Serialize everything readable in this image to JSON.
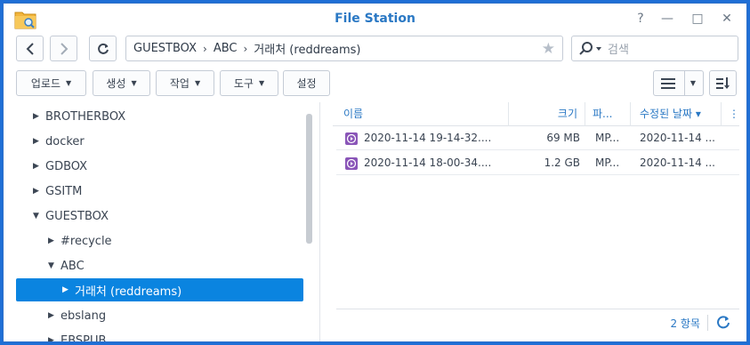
{
  "window": {
    "title": "File Station",
    "help_icon": "?",
    "minimize_icon": "—",
    "maximize_icon": "□",
    "close_icon": "✕"
  },
  "toolbar": {
    "back_icon": "chevron-left-icon",
    "forward_icon": "chevron-right-icon",
    "refresh_icon": "refresh-icon",
    "breadcrumb": [
      "GUESTBOX",
      "ABC",
      "거래처 (reddreams)"
    ],
    "favorite_icon": "★",
    "search_placeholder": "검색",
    "actions": [
      {
        "label": "업로드",
        "caret": "▼"
      },
      {
        "label": "생성",
        "caret": "▼"
      },
      {
        "label": "작업",
        "caret": "▼"
      },
      {
        "label": "도구",
        "caret": "▼"
      },
      {
        "label": "설정"
      }
    ],
    "view_mode_icon": "list-icon",
    "sort_icon": "sort-icon"
  },
  "sidebar": {
    "items": [
      {
        "label": "BROTHERBOX",
        "expanded": false,
        "level": 0
      },
      {
        "label": "docker",
        "expanded": false,
        "level": 0
      },
      {
        "label": "GDBOX",
        "expanded": false,
        "level": 0
      },
      {
        "label": "GSITM",
        "expanded": false,
        "level": 0
      },
      {
        "label": "GUESTBOX",
        "expanded": true,
        "level": 0
      },
      {
        "label": "#recycle",
        "expanded": false,
        "level": 1
      },
      {
        "label": "ABC",
        "expanded": true,
        "level": 1
      },
      {
        "label": "거래처 (reddreams)",
        "expanded": false,
        "level": 2,
        "selected": true
      },
      {
        "label": "ebslang",
        "expanded": false,
        "level": 1
      },
      {
        "label": "EBSPUB",
        "expanded": false,
        "level": 1
      }
    ]
  },
  "file_list": {
    "columns": [
      "이름",
      "크기",
      "파...",
      "수정된 날짜"
    ],
    "sort_indicator": "▾",
    "more_icon": "⋮",
    "rows": [
      {
        "name": "2020-11-14 19-14-32....",
        "size": "69 MB",
        "type": "MP...",
        "modified": "2020-11-14 ..."
      },
      {
        "name": "2020-11-14 18-00-34....",
        "size": "1.2 GB",
        "type": "MP...",
        "modified": "2020-11-14 ..."
      }
    ],
    "item_count": "2 항목"
  },
  "colors": {
    "accent": "#2a78c4",
    "selection": "#0a84e0",
    "file_icon": "#8a55b8",
    "frame": "#1f6fd6"
  }
}
